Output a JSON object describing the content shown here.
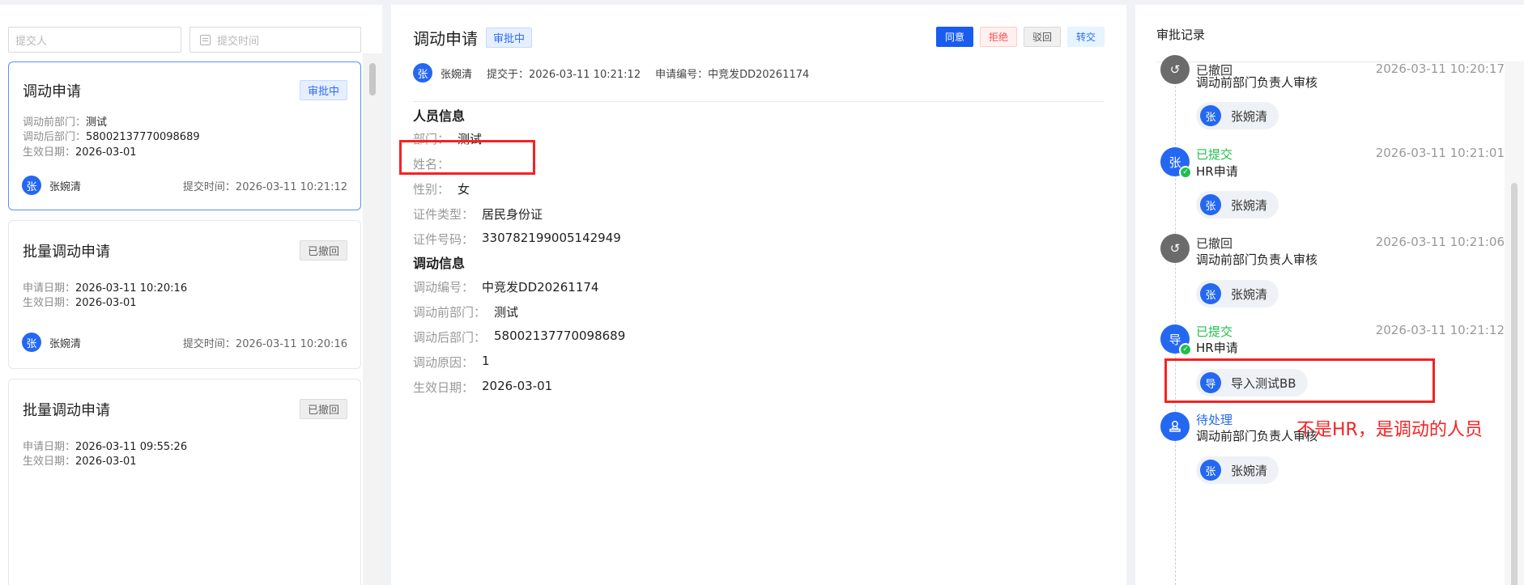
{
  "filters": {
    "submitter_placeholder": "提交人",
    "time_placeholder": "提交时间"
  },
  "list": [
    {
      "title": "调动申请",
      "tag": "审批中",
      "row1_label": "调动前部门：",
      "row1_value": "测试",
      "row2_label": "调动后部门：",
      "row2_value": "58002137770098689",
      "row3_label": "生效日期：",
      "row3_value": "2026-03-01",
      "avatar": "张",
      "user": "张婉清",
      "submit_time": "提交时间：2026-03-11 10:21:12"
    },
    {
      "title": "批量调动申请",
      "tag": "已撤回",
      "row1_label": "申请日期：",
      "row1_value": "2026-03-11 10:20:16",
      "row2_label": "生效日期：",
      "row2_value": "2026-03-01",
      "avatar": "张",
      "user": "张婉清",
      "submit_time": "提交时间：2026-03-11 10:20:16"
    },
    {
      "title": "批量调动申请",
      "tag": "已撤回",
      "row1_label": "申请日期：",
      "row1_value": "2026-03-11 09:55:26",
      "row2_label": "生效日期：",
      "row2_value": "2026-03-01"
    }
  ],
  "detail": {
    "title": "调动申请",
    "status": "审批中",
    "actions": {
      "approve": "同意",
      "reject": "拒绝",
      "return": "驳回",
      "transfer": "转交"
    },
    "meta": {
      "avatar": "张",
      "user": "张婉清",
      "submitted": "提交于：2026-03-11 10:21:12",
      "request_no": "申请编号：中竞发DD20261174"
    },
    "person_section": "人员信息",
    "person": {
      "dept_k": "部门：",
      "dept_v": "测试",
      "name_k": "姓名：",
      "gender_k": "性别：",
      "gender_v": "女",
      "idtype_k": "证件类型：",
      "idtype_v": "居民身份证",
      "idno_k": "证件号码：",
      "idno_v": "330782199005142949"
    },
    "transfer_section": "调动信息",
    "transfer": {
      "no_k": "调动编号：",
      "no_v": "中竞发DD20261174",
      "before_k": "调动前部门：",
      "before_v": "测试",
      "after_k": "调动后部门：",
      "after_v": "58002137770098689",
      "reason_k": "调动原因：",
      "reason_v": "1",
      "date_k": "生效日期：",
      "date_v": "2026-03-01"
    }
  },
  "approval": {
    "title": "审批记录",
    "entries": [
      {
        "status": "已撤回",
        "time": "2026-03-11 10:20:17",
        "node": "调动前部门负责人审核",
        "avatar": "张",
        "user": "张婉清"
      },
      {
        "icon_text": "张",
        "status": "已提交",
        "time": "2026-03-11 10:21:01",
        "node": "HR申请",
        "avatar": "张",
        "user": "张婉清"
      },
      {
        "status": "已撤回",
        "time": "2026-03-11 10:21:06",
        "node": "调动前部门负责人审核",
        "avatar": "张",
        "user": "张婉清"
      },
      {
        "icon_text": "导",
        "status": "已提交",
        "time": "2026-03-11 10:21:12",
        "node": "HR申请",
        "avatar": "导",
        "user": "导入测试BB"
      },
      {
        "status": "待处理",
        "node": "调动前部门负责人审核",
        "avatar": "张",
        "user": "张婉清"
      }
    ]
  },
  "annotation": "不是HR，是调动的人员",
  "colors": {
    "primary": "#2468f2",
    "success": "#1fbf4c",
    "annotation_red": "#f52222"
  }
}
